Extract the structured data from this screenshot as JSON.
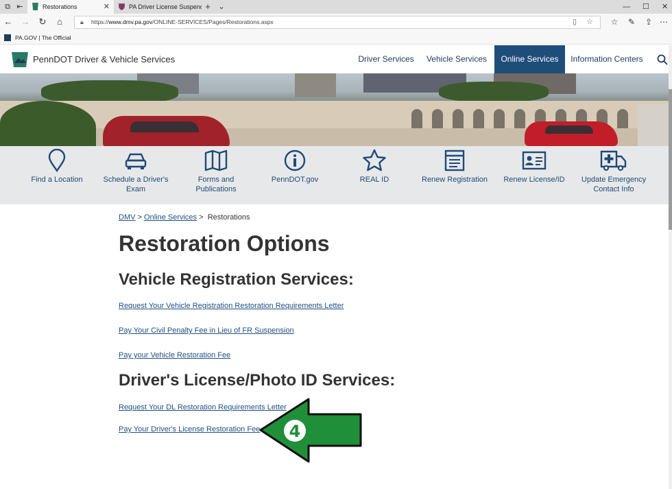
{
  "browser": {
    "tabs": [
      {
        "label": "Restorations",
        "active": true
      },
      {
        "label": "PA Driver License Suspende",
        "active": false
      }
    ],
    "new_tab_icon": "+",
    "url_prefix": "https://",
    "url_domain": "www.dmv.pa.gov",
    "url_path": "/ONLINE-SERVICES/Pages/Restorations.aspx",
    "favorites": [
      {
        "label": "PA.GOV | The Official"
      }
    ]
  },
  "site": {
    "title": "PennDOT Driver & Vehicle Services",
    "nav": [
      {
        "label": "Driver Services",
        "active": false
      },
      {
        "label": "Vehicle Services",
        "active": false
      },
      {
        "label": "Online Services",
        "active": true
      },
      {
        "label": "Information Centers",
        "active": false
      }
    ],
    "accent_color": "#1f4d7a"
  },
  "quick_links": [
    {
      "label": "Find a Location",
      "icon": "map-pin-icon"
    },
    {
      "label": "Schedule a Driver's Exam",
      "icon": "car-icon"
    },
    {
      "label": "Forms and Publications",
      "icon": "map-book-icon"
    },
    {
      "label": "PennDOT.gov",
      "icon": "info-icon"
    },
    {
      "label": "REAL ID",
      "icon": "star-icon"
    },
    {
      "label": "Renew Registration",
      "icon": "form-icon"
    },
    {
      "label": "Renew License/ID",
      "icon": "id-card-icon"
    },
    {
      "label": "Update Emergency Contact Info",
      "icon": "ambulance-icon"
    }
  ],
  "breadcrumb": {
    "items": [
      "DMV",
      "Online Services"
    ],
    "current": "Restorations",
    "separator": ">"
  },
  "content": {
    "title": "Restoration Options",
    "sections": [
      {
        "heading": "Vehicle Registration Services:",
        "links": [
          "Request Your Vehicle Registration Restoration Requirements Letter",
          "Pay Your Civil Penalty Fee in Lieu of FR Suspension",
          "Pay your Vehicle Restoration Fee"
        ]
      },
      {
        "heading": "Driver's License/Photo ID Services:",
        "links": [
          "Request Your DL Restoration Requirements Letter",
          "Pay Your Driver's License Restoration Fee"
        ]
      }
    ]
  },
  "annotation": {
    "step": "4",
    "color": "#1f8f3a"
  }
}
